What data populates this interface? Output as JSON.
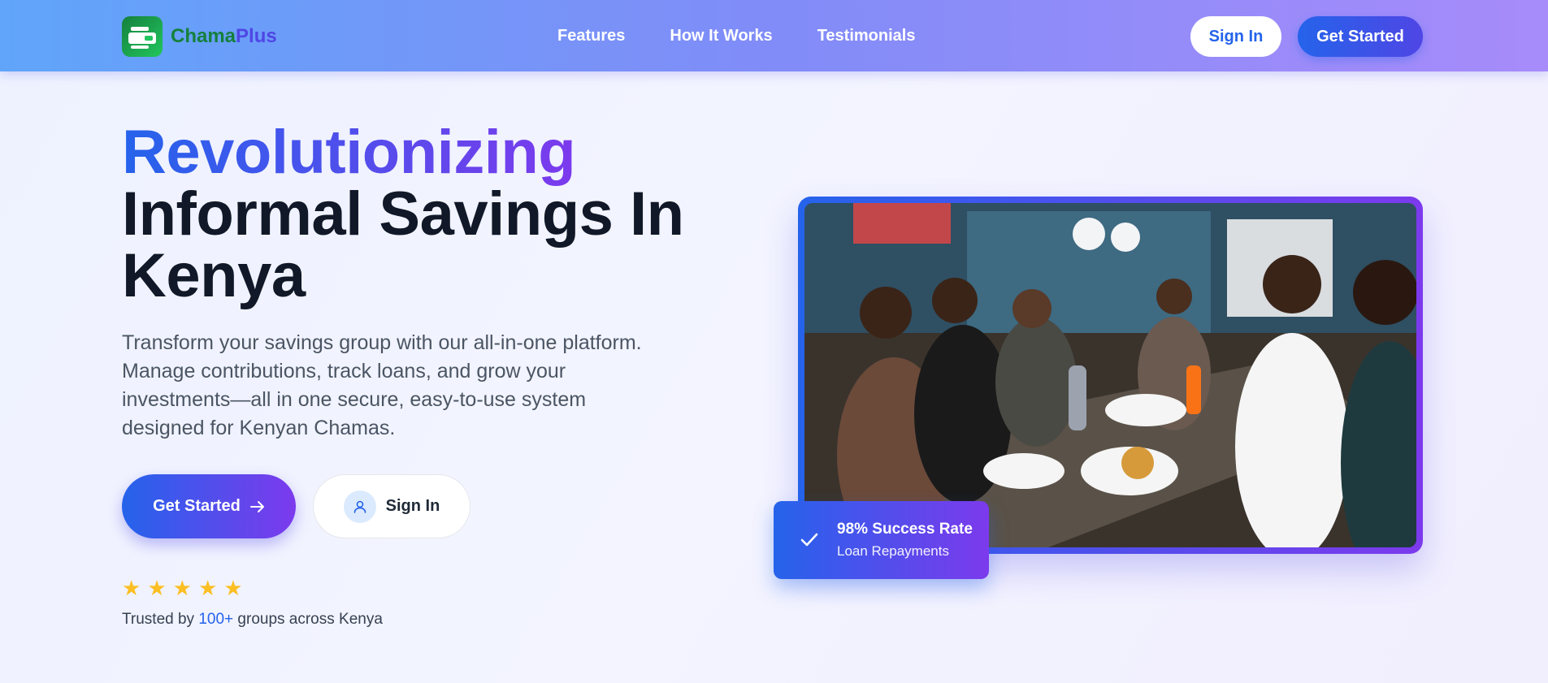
{
  "brand": {
    "name_part1": "Chama",
    "name_part2": "Plus"
  },
  "nav": {
    "links": [
      "Features",
      "How It Works",
      "Testimonials"
    ],
    "sign_in": "Sign In",
    "get_started": "Get Started"
  },
  "hero": {
    "title_highlight": "Revolutionizing",
    "title_line2": "Informal Savings In",
    "title_line3": "Kenya",
    "description": "Transform your savings group with our all-in-one platform. Manage contributions, track loans, and grow your investments—all in one secure, easy-to-use system designed for Kenyan Chamas.",
    "cta_primary": "Get Started",
    "cta_secondary": "Sign In",
    "rating_stars": 5,
    "trusted_prefix": "Trusted by ",
    "trusted_count": "100+",
    "trusted_suffix": " groups across Kenya"
  },
  "badge": {
    "title": "98% Success Rate",
    "subtitle": "Loan Repayments"
  },
  "colors": {
    "primary": "#2563eb",
    "accent": "#7c3aed",
    "brand_green": "#15803d",
    "star": "#fbbf24"
  },
  "icons": [
    "wallet-icon",
    "arrow-right-icon",
    "user-icon",
    "star-icon",
    "check-icon"
  ]
}
